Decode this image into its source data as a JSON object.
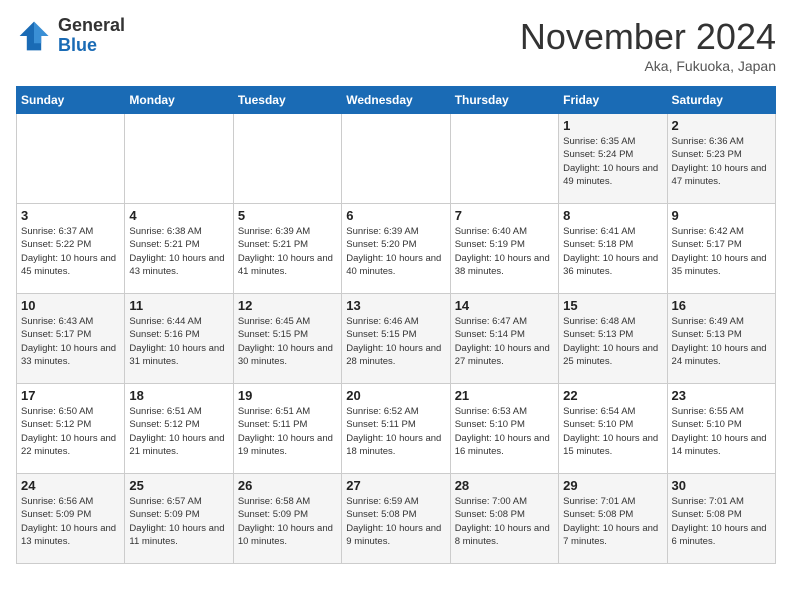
{
  "header": {
    "logo_general": "General",
    "logo_blue": "Blue",
    "month_title": "November 2024",
    "location": "Aka, Fukuoka, Japan"
  },
  "weekdays": [
    "Sunday",
    "Monday",
    "Tuesday",
    "Wednesday",
    "Thursday",
    "Friday",
    "Saturday"
  ],
  "weeks": [
    [
      {
        "day": "",
        "info": ""
      },
      {
        "day": "",
        "info": ""
      },
      {
        "day": "",
        "info": ""
      },
      {
        "day": "",
        "info": ""
      },
      {
        "day": "",
        "info": ""
      },
      {
        "day": "1",
        "info": "Sunrise: 6:35 AM\nSunset: 5:24 PM\nDaylight: 10 hours\nand 49 minutes."
      },
      {
        "day": "2",
        "info": "Sunrise: 6:36 AM\nSunset: 5:23 PM\nDaylight: 10 hours\nand 47 minutes."
      }
    ],
    [
      {
        "day": "3",
        "info": "Sunrise: 6:37 AM\nSunset: 5:22 PM\nDaylight: 10 hours\nand 45 minutes."
      },
      {
        "day": "4",
        "info": "Sunrise: 6:38 AM\nSunset: 5:21 PM\nDaylight: 10 hours\nand 43 minutes."
      },
      {
        "day": "5",
        "info": "Sunrise: 6:39 AM\nSunset: 5:21 PM\nDaylight: 10 hours\nand 41 minutes."
      },
      {
        "day": "6",
        "info": "Sunrise: 6:39 AM\nSunset: 5:20 PM\nDaylight: 10 hours\nand 40 minutes."
      },
      {
        "day": "7",
        "info": "Sunrise: 6:40 AM\nSunset: 5:19 PM\nDaylight: 10 hours\nand 38 minutes."
      },
      {
        "day": "8",
        "info": "Sunrise: 6:41 AM\nSunset: 5:18 PM\nDaylight: 10 hours\nand 36 minutes."
      },
      {
        "day": "9",
        "info": "Sunrise: 6:42 AM\nSunset: 5:17 PM\nDaylight: 10 hours\nand 35 minutes."
      }
    ],
    [
      {
        "day": "10",
        "info": "Sunrise: 6:43 AM\nSunset: 5:17 PM\nDaylight: 10 hours\nand 33 minutes."
      },
      {
        "day": "11",
        "info": "Sunrise: 6:44 AM\nSunset: 5:16 PM\nDaylight: 10 hours\nand 31 minutes."
      },
      {
        "day": "12",
        "info": "Sunrise: 6:45 AM\nSunset: 5:15 PM\nDaylight: 10 hours\nand 30 minutes."
      },
      {
        "day": "13",
        "info": "Sunrise: 6:46 AM\nSunset: 5:15 PM\nDaylight: 10 hours\nand 28 minutes."
      },
      {
        "day": "14",
        "info": "Sunrise: 6:47 AM\nSunset: 5:14 PM\nDaylight: 10 hours\nand 27 minutes."
      },
      {
        "day": "15",
        "info": "Sunrise: 6:48 AM\nSunset: 5:13 PM\nDaylight: 10 hours\nand 25 minutes."
      },
      {
        "day": "16",
        "info": "Sunrise: 6:49 AM\nSunset: 5:13 PM\nDaylight: 10 hours\nand 24 minutes."
      }
    ],
    [
      {
        "day": "17",
        "info": "Sunrise: 6:50 AM\nSunset: 5:12 PM\nDaylight: 10 hours\nand 22 minutes."
      },
      {
        "day": "18",
        "info": "Sunrise: 6:51 AM\nSunset: 5:12 PM\nDaylight: 10 hours\nand 21 minutes."
      },
      {
        "day": "19",
        "info": "Sunrise: 6:51 AM\nSunset: 5:11 PM\nDaylight: 10 hours\nand 19 minutes."
      },
      {
        "day": "20",
        "info": "Sunrise: 6:52 AM\nSunset: 5:11 PM\nDaylight: 10 hours\nand 18 minutes."
      },
      {
        "day": "21",
        "info": "Sunrise: 6:53 AM\nSunset: 5:10 PM\nDaylight: 10 hours\nand 16 minutes."
      },
      {
        "day": "22",
        "info": "Sunrise: 6:54 AM\nSunset: 5:10 PM\nDaylight: 10 hours\nand 15 minutes."
      },
      {
        "day": "23",
        "info": "Sunrise: 6:55 AM\nSunset: 5:10 PM\nDaylight: 10 hours\nand 14 minutes."
      }
    ],
    [
      {
        "day": "24",
        "info": "Sunrise: 6:56 AM\nSunset: 5:09 PM\nDaylight: 10 hours\nand 13 minutes."
      },
      {
        "day": "25",
        "info": "Sunrise: 6:57 AM\nSunset: 5:09 PM\nDaylight: 10 hours\nand 11 minutes."
      },
      {
        "day": "26",
        "info": "Sunrise: 6:58 AM\nSunset: 5:09 PM\nDaylight: 10 hours\nand 10 minutes."
      },
      {
        "day": "27",
        "info": "Sunrise: 6:59 AM\nSunset: 5:08 PM\nDaylight: 10 hours\nand 9 minutes."
      },
      {
        "day": "28",
        "info": "Sunrise: 7:00 AM\nSunset: 5:08 PM\nDaylight: 10 hours\nand 8 minutes."
      },
      {
        "day": "29",
        "info": "Sunrise: 7:01 AM\nSunset: 5:08 PM\nDaylight: 10 hours\nand 7 minutes."
      },
      {
        "day": "30",
        "info": "Sunrise: 7:01 AM\nSunset: 5:08 PM\nDaylight: 10 hours\nand 6 minutes."
      }
    ]
  ]
}
